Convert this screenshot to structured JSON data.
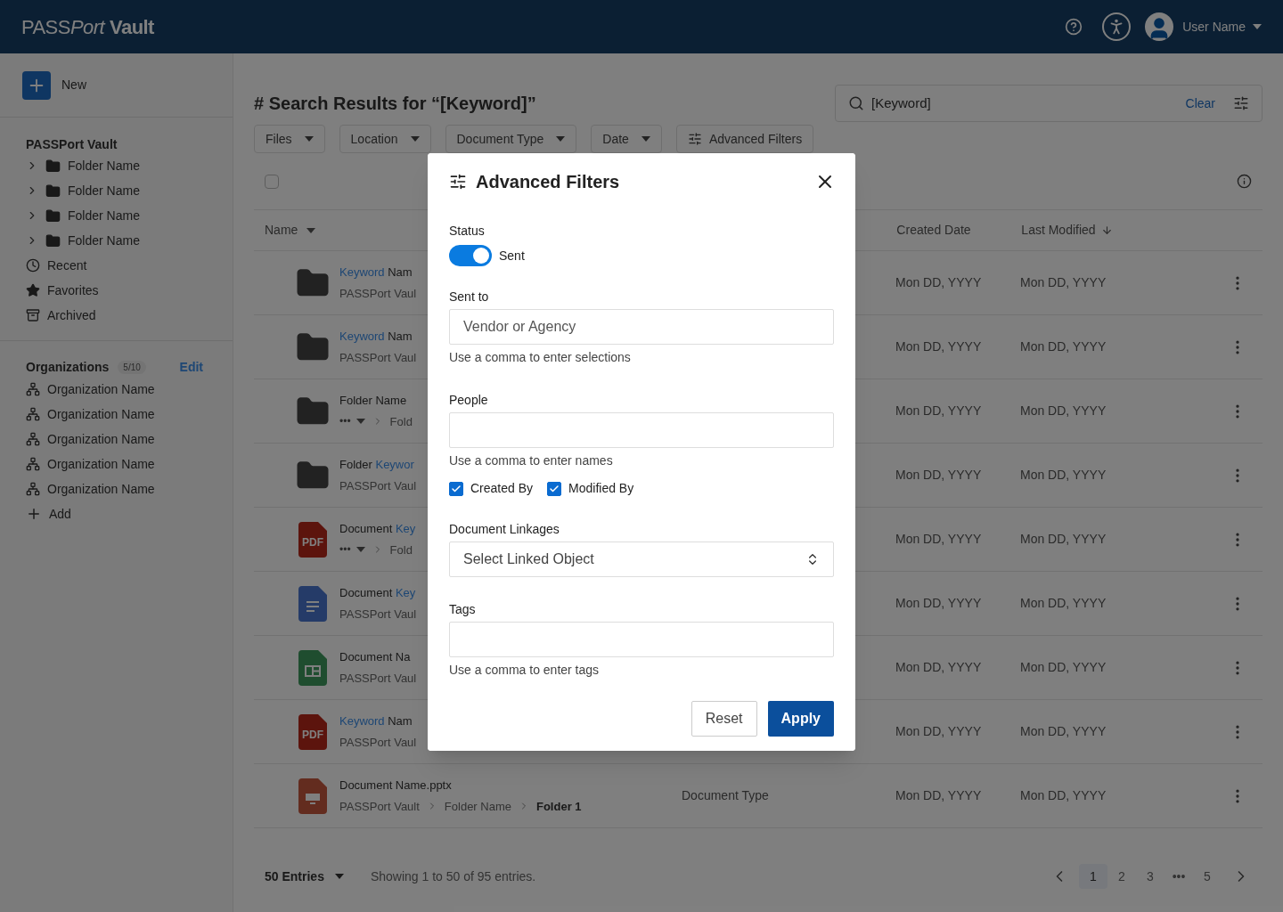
{
  "header": {
    "logo": [
      "PASS",
      "Port",
      "Vault"
    ],
    "user_name": "User Name"
  },
  "sidebar": {
    "new_label": "New",
    "vault_title": "PASSPort Vault",
    "folders": [
      "Folder Name",
      "Folder Name",
      "Folder Name",
      "Folder Name"
    ],
    "links": [
      {
        "kind": "recent",
        "label": "Recent"
      },
      {
        "kind": "favorites",
        "label": "Favorites"
      },
      {
        "kind": "archived",
        "label": "Archived"
      }
    ],
    "organizations": {
      "title": "Organizations",
      "count": "5/10",
      "edit": "Edit",
      "items": [
        "Organization Name",
        "Organization Name",
        "Organization Name",
        "Organization Name",
        "Organization Name"
      ],
      "add": "Add"
    }
  },
  "main": {
    "title": "# Search Results for “[Keyword]”",
    "search": {
      "value": "[Keyword]",
      "clear": "Clear"
    },
    "filters": [
      "Files",
      "Location",
      "Document Type",
      "Date"
    ],
    "advanced_filters": "Advanced Filters",
    "select_all": {
      "checked": false
    },
    "columns": {
      "name": "Name",
      "created": "Created Date",
      "modified": "Last Modified"
    },
    "rows": [
      {
        "kind": "folder",
        "name": [
          {
            "text": "Keyword",
            "match": true
          },
          {
            "text": " Nam",
            "match": false
          }
        ],
        "path": [
          {
            "kind": "crumb",
            "text": "PASSPort Vaul"
          }
        ],
        "created": "Mon DD, YYYY",
        "modified": "Mon DD, YYYY"
      },
      {
        "kind": "folder",
        "name": [
          {
            "text": "Keyword",
            "match": true
          },
          {
            "text": " Nam",
            "match": false
          }
        ],
        "path": [
          {
            "kind": "crumb",
            "text": "PASSPort Vaul"
          }
        ],
        "created": "Mon DD, YYYY",
        "modified": "Mon DD, YYYY"
      },
      {
        "kind": "folder",
        "name": [
          {
            "text": "Folder Name",
            "match": false
          }
        ],
        "path": [
          {
            "kind": "menu",
            "text": "•••"
          },
          {
            "kind": "crumb",
            "text": "Fold"
          }
        ],
        "created": "Mon DD, YYYY",
        "modified": "Mon DD, YYYY"
      },
      {
        "kind": "folder",
        "name": [
          {
            "text": "Folder ",
            "match": false
          },
          {
            "text": "Keywor",
            "match": true
          }
        ],
        "path": [
          {
            "kind": "crumb",
            "text": "PASSPort Vaul"
          }
        ],
        "created": "Mon DD, YYYY",
        "modified": "Mon DD, YYYY"
      },
      {
        "kind": "pdf",
        "badge": "PDF",
        "name": [
          {
            "text": "Document ",
            "match": false
          },
          {
            "text": "Key",
            "match": true
          }
        ],
        "path": [
          {
            "kind": "menu",
            "text": "•••"
          },
          {
            "kind": "crumb",
            "text": "Fold"
          }
        ],
        "created": "Mon DD, YYYY",
        "modified": "Mon DD, YYYY"
      },
      {
        "kind": "doc",
        "name": [
          {
            "text": "Document ",
            "match": false
          },
          {
            "text": "Key",
            "match": true
          }
        ],
        "path": [
          {
            "kind": "crumb",
            "text": "PASSPort Vaul"
          }
        ],
        "created": "Mon DD, YYYY",
        "modified": "Mon DD, YYYY"
      },
      {
        "kind": "sheet",
        "name": [
          {
            "text": "Document Na",
            "match": false
          }
        ],
        "path": [
          {
            "kind": "crumb",
            "text": "PASSPort Vaul"
          }
        ],
        "created": "Mon DD, YYYY",
        "modified": "Mon DD, YYYY"
      },
      {
        "kind": "pdf",
        "badge": "PDF",
        "name": [
          {
            "text": "Keyword",
            "match": true
          },
          {
            "text": " Nam",
            "match": false
          }
        ],
        "path": [
          {
            "kind": "crumb",
            "text": "PASSPort Vaul"
          }
        ],
        "created": "Mon DD, YYYY",
        "modified": "Mon DD, YYYY"
      },
      {
        "kind": "slides",
        "name": [
          {
            "text": "Document Name.pptx",
            "match": false
          }
        ],
        "path": [
          {
            "kind": "crumb",
            "text": "PASSPort Vault"
          },
          {
            "kind": "crumb",
            "text": "Folder Name"
          },
          {
            "kind": "current",
            "text": "Folder 1"
          }
        ],
        "type": "Document Type",
        "created": "Mon DD, YYYY",
        "modified": "Mon DD, YYYY"
      }
    ],
    "footer": {
      "entries": "50 Entries",
      "showing": "Showing 1 to 50 of 95 entries.",
      "pages": [
        {
          "label": "1",
          "selected": true
        },
        {
          "label": "2",
          "selected": false
        },
        {
          "label": "3",
          "selected": false
        },
        {
          "label": "•••",
          "selected": false
        },
        {
          "label": "5",
          "selected": false
        }
      ]
    }
  },
  "modal": {
    "title": "Advanced Filters",
    "status": {
      "label": "Status",
      "toggle_label": "Sent",
      "on": true
    },
    "sent_to": {
      "label": "Sent to",
      "placeholder": "Vendor or Agency",
      "hint": "Use a comma to enter selections"
    },
    "people": {
      "label": "People",
      "hint": "Use a comma to enter names",
      "options": [
        {
          "label": "Created By",
          "checked": true
        },
        {
          "label": "Modified By",
          "checked": true
        }
      ]
    },
    "linkages": {
      "label": "Document Linkages",
      "placeholder": "Select Linked Object"
    },
    "tags": {
      "label": "Tags",
      "hint": "Use a comma to enter tags"
    },
    "reset": "Reset",
    "apply": "Apply"
  }
}
